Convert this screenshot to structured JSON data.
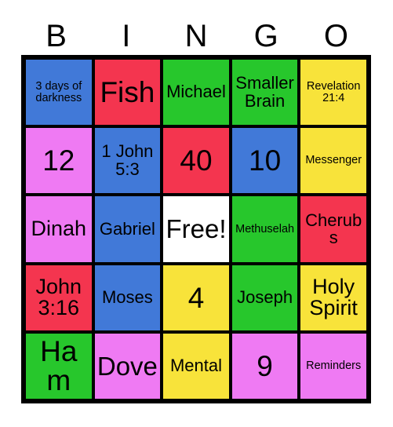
{
  "title": "BINGO card",
  "header": {
    "letters": [
      "B",
      "I",
      "N",
      "G",
      "O"
    ]
  },
  "palette": {
    "blue": "#4179d8",
    "red": "#f4354f",
    "green": "#27c72c",
    "yellow": "#f8e33a",
    "pink": "#ef7af3",
    "white": "#ffffff",
    "border": "#000000",
    "text": "#000000",
    "background": "#ffffff"
  },
  "grid": {
    "rows": 5,
    "columns": 5,
    "free_space": {
      "row": 3,
      "column": 3,
      "label": "Free!"
    },
    "cells": [
      [
        {
          "label": "3 days of darkness",
          "color": "#4179d8",
          "color_name": "blue",
          "size": "xs"
        },
        {
          "label": "Fish",
          "color": "#f4354f",
          "color_name": "red",
          "size": "xxl"
        },
        {
          "label": "Michael",
          "color": "#27c72c",
          "color_name": "green",
          "size": "m"
        },
        {
          "label": "Smaller Brain",
          "color": "#27c72c",
          "color_name": "green",
          "size": "m"
        },
        {
          "label": "Revelation 21:4",
          "color": "#f8e33a",
          "color_name": "yellow",
          "size": "xs"
        }
      ],
      [
        {
          "label": "12",
          "color": "#ef7af3",
          "color_name": "pink",
          "size": "xxl"
        },
        {
          "label": "1 John 5:3",
          "color": "#4179d8",
          "color_name": "blue",
          "size": "m"
        },
        {
          "label": "40",
          "color": "#f4354f",
          "color_name": "red",
          "size": "xxl"
        },
        {
          "label": "10",
          "color": "#4179d8",
          "color_name": "blue",
          "size": "xxl"
        },
        {
          "label": "Messenger",
          "color": "#f8e33a",
          "color_name": "yellow",
          "size": "xs"
        }
      ],
      [
        {
          "label": "Dinah",
          "color": "#ef7af3",
          "color_name": "pink",
          "size": "l"
        },
        {
          "label": "Gabriel",
          "color": "#4179d8",
          "color_name": "blue",
          "size": "m"
        },
        {
          "label": "Free!",
          "color": "#ffffff",
          "color_name": "white",
          "size": "xl"
        },
        {
          "label": "Methuselah",
          "color": "#27c72c",
          "color_name": "green",
          "size": "xs"
        },
        {
          "label": "Cherubs",
          "color": "#f4354f",
          "color_name": "red",
          "size": "m"
        }
      ],
      [
        {
          "label": "John 3:16",
          "color": "#f4354f",
          "color_name": "red",
          "size": "l"
        },
        {
          "label": "Moses",
          "color": "#4179d8",
          "color_name": "blue",
          "size": "m"
        },
        {
          "label": "4",
          "color": "#f8e33a",
          "color_name": "yellow",
          "size": "xxl"
        },
        {
          "label": "Joseph",
          "color": "#27c72c",
          "color_name": "green",
          "size": "m"
        },
        {
          "label": "Holy Spirit",
          "color": "#f8e33a",
          "color_name": "yellow",
          "size": "l"
        }
      ],
      [
        {
          "label": "Ham",
          "color": "#27c72c",
          "color_name": "green",
          "size": "xxl"
        },
        {
          "label": "Dove",
          "color": "#ef7af3",
          "color_name": "pink",
          "size": "xl"
        },
        {
          "label": "Mental",
          "color": "#f8e33a",
          "color_name": "yellow",
          "size": "m"
        },
        {
          "label": "9",
          "color": "#ef7af3",
          "color_name": "pink",
          "size": "xxl"
        },
        {
          "label": "Reminders",
          "color": "#ef7af3",
          "color_name": "pink",
          "size": "xs"
        }
      ]
    ]
  }
}
